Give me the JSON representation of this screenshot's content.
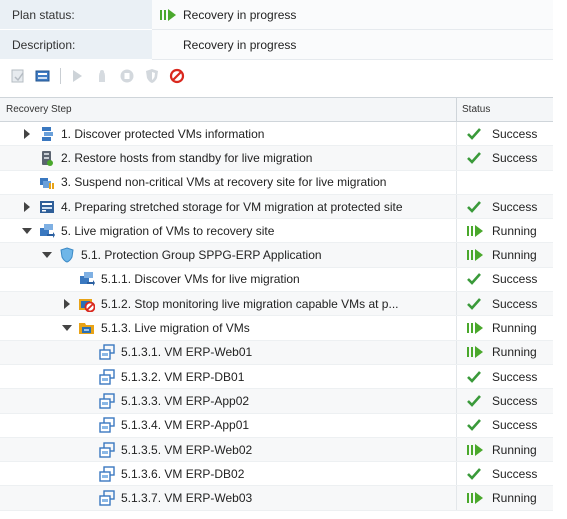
{
  "plan": {
    "status_label": "Plan status:",
    "status_value": "Recovery in progress",
    "description_label": "Description:",
    "description_value": "Recovery in progress"
  },
  "toolbar": {
    "buttons": [
      "test-icon",
      "cleanup-icon",
      "run-icon",
      "reprotect-icon",
      "pause-icon",
      "resume-icon",
      "cancel-icon"
    ]
  },
  "grid": {
    "col_step": "Recovery Step",
    "col_status": "Status",
    "rows": [
      {
        "indent": 0,
        "toggle": "collapsed",
        "icon": "vm-group-icon",
        "label": "1. Discover protected VMs information",
        "status": "Success"
      },
      {
        "indent": 0,
        "toggle": "none",
        "icon": "host-icon",
        "label": "2. Restore hosts from standby for live migration",
        "status": "Success"
      },
      {
        "indent": 0,
        "toggle": "none",
        "icon": "suspend-vms-icon",
        "label": "3. Suspend non-critical VMs at recovery site for live migration",
        "status": ""
      },
      {
        "indent": 0,
        "toggle": "collapsed",
        "icon": "storage-icon",
        "label": "4. Preparing stretched storage for VM migration at protected site",
        "status": "Success"
      },
      {
        "indent": 0,
        "toggle": "expanded",
        "icon": "migrate-icon",
        "label": "5. Live migration of VMs to recovery site",
        "status": "Running"
      },
      {
        "indent": 1,
        "toggle": "expanded",
        "icon": "protection-group-icon",
        "label": "5.1. Protection Group SPPG-ERP Application",
        "status": "Running"
      },
      {
        "indent": 2,
        "toggle": "none",
        "icon": "migrate-icon",
        "label": "5.1.1. Discover VMs for live migration",
        "status": "Success"
      },
      {
        "indent": 2,
        "toggle": "collapsed",
        "icon": "stop-monitor-icon",
        "label": "5.1.2. Stop monitoring live migration capable VMs at p...",
        "status": "Success"
      },
      {
        "indent": 2,
        "toggle": "expanded",
        "icon": "vm-folder-icon",
        "label": "5.1.3. Live migration of VMs",
        "status": "Running"
      },
      {
        "indent": 3,
        "toggle": "none",
        "icon": "vm-icon",
        "label": "5.1.3.1. VM ERP-Web01",
        "status": "Running"
      },
      {
        "indent": 3,
        "toggle": "none",
        "icon": "vm-icon",
        "label": "5.1.3.2. VM ERP-DB01",
        "status": "Success"
      },
      {
        "indent": 3,
        "toggle": "none",
        "icon": "vm-icon",
        "label": "5.1.3.3. VM ERP-App02",
        "status": "Success"
      },
      {
        "indent": 3,
        "toggle": "none",
        "icon": "vm-icon",
        "label": "5.1.3.4. VM ERP-App01",
        "status": "Success"
      },
      {
        "indent": 3,
        "toggle": "none",
        "icon": "vm-icon",
        "label": "5.1.3.5. VM ERP-Web02",
        "status": "Running"
      },
      {
        "indent": 3,
        "toggle": "none",
        "icon": "vm-icon",
        "label": "5.1.3.6. VM ERP-DB02",
        "status": "Success"
      },
      {
        "indent": 3,
        "toggle": "none",
        "icon": "vm-icon",
        "label": "5.1.3.7. VM ERP-Web03",
        "status": "Running"
      }
    ]
  },
  "colors": {
    "success": "#3a9a3a",
    "running": "#4aa82c",
    "cancel": "#d9281e",
    "header_bg": "#eaf0f5",
    "accent_blue": "#2a6fb5"
  }
}
